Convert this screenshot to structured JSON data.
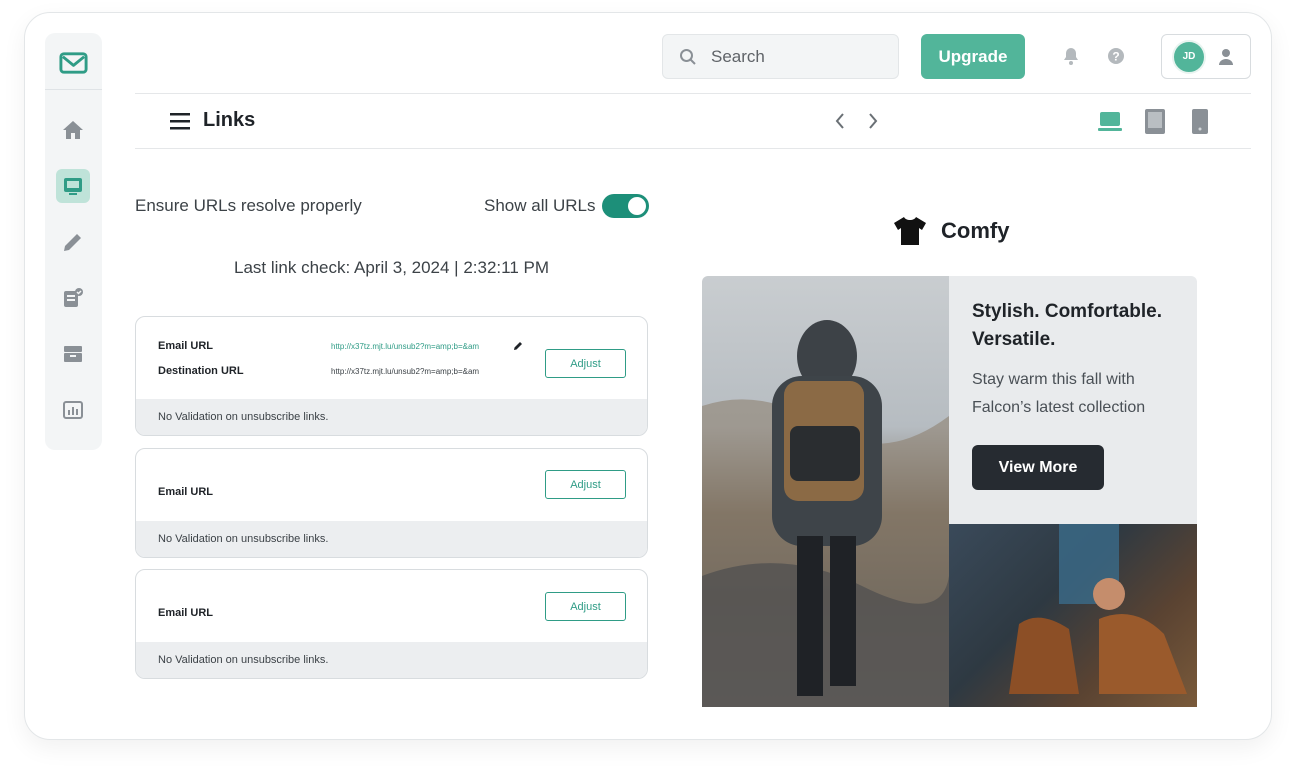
{
  "topbar": {
    "search_placeholder": "Search",
    "upgrade_label": "Upgrade",
    "avatar_initials": "JD"
  },
  "header": {
    "title": "Links"
  },
  "settings": {
    "ensure_label": "Ensure URLs resolve properly",
    "show_all_label": "Show all URLs",
    "show_all_on": true,
    "last_check": "Last link check: April 3, 2024 | 2:32:11 PM"
  },
  "cards": [
    {
      "email_label": "Email URL",
      "email_url": "http://x37tz.mjt.lu/unsub2?m=amp;b=&am",
      "dest_label": "Destination URL",
      "dest_url": "http://x37tz.mjt.lu/unsub2?m=amp;b=&am",
      "adjust_label": "Adjust",
      "footer": "No Validation on unsubscribe links."
    },
    {
      "email_label": "Email URL",
      "adjust_label": "Adjust",
      "footer": "No Validation on unsubscribe links."
    },
    {
      "email_label": "Email URL",
      "adjust_label": "Adjust",
      "footer": "No Validation on unsubscribe links."
    }
  ],
  "preview": {
    "brand": "Comfy",
    "headline": "Stylish. Comfortable. Versatile.",
    "subtext": "Stay warm this fall with Falcon’s latest collection",
    "cta": "View More"
  },
  "colors": {
    "accent": "#52b59a",
    "accent_dark": "#1d8f79",
    "url_green": "#2f9c86"
  },
  "icons": {
    "sidebar": [
      "home-icon",
      "inbox-icon",
      "pencil-icon",
      "checklist-icon",
      "archive-icon",
      "chart-icon"
    ],
    "topbar": [
      "search-icon",
      "notification-icon",
      "help-icon",
      "user-icon"
    ],
    "devices": [
      "desktop-icon",
      "tablet-icon",
      "mobile-icon"
    ]
  }
}
